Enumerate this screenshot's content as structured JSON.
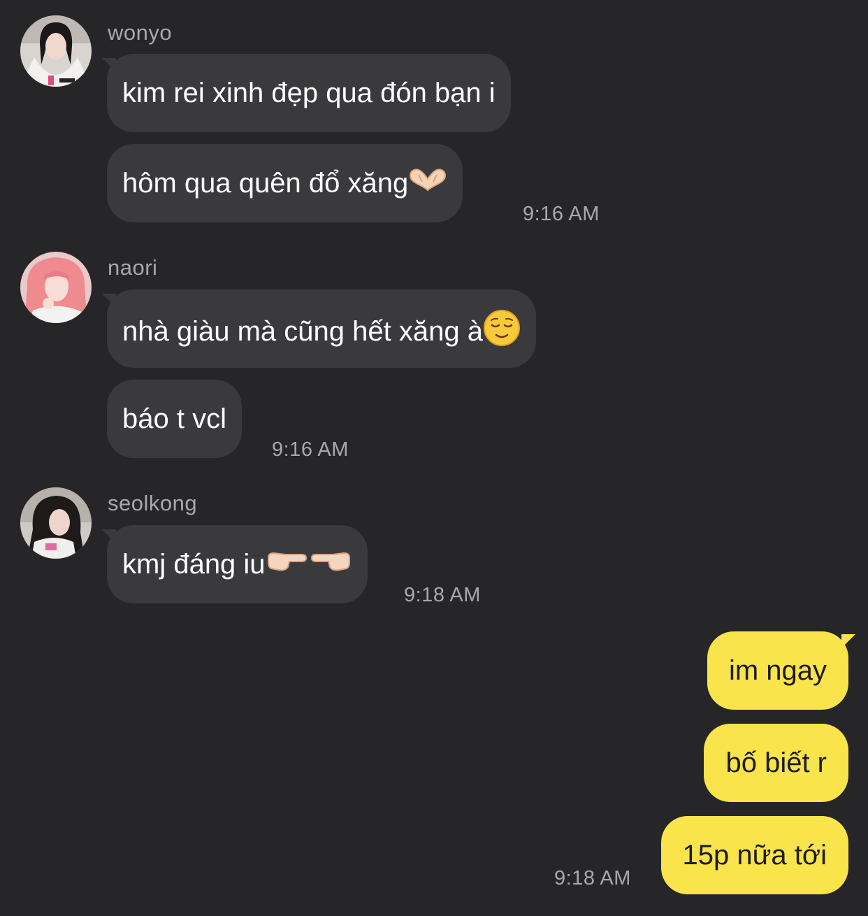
{
  "messages": {
    "group1": {
      "sender": "wonyo",
      "bubble1": "kim rei xinh đẹp qua đón bạn i",
      "bubble2": "hôm qua quên đổ xăng",
      "bubble2_emoji": "heart-hands-emoji",
      "time": "9:16 AM"
    },
    "group2": {
      "sender": "naori",
      "bubble1": "nhà giàu mà cũng hết xăng à",
      "bubble1_emoji": "relieved-face-emoji",
      "bubble2": "báo t vcl",
      "time": "9:16 AM"
    },
    "group3": {
      "sender": "seolkong",
      "bubble1": "kmj đáng iu",
      "bubble1_emoji": "index-pointing-emojis",
      "time": "9:18 AM"
    },
    "mine": {
      "bubble1": "im ngay",
      "bubble2": "bố biết r",
      "bubble3": "15p nữa tới",
      "time": "9:18 AM"
    }
  },
  "colors": {
    "background": "#262628",
    "incoming_bubble": "#3a3a3d",
    "outgoing_bubble": "#f9e44b",
    "meta_text": "#a9a9ad"
  }
}
